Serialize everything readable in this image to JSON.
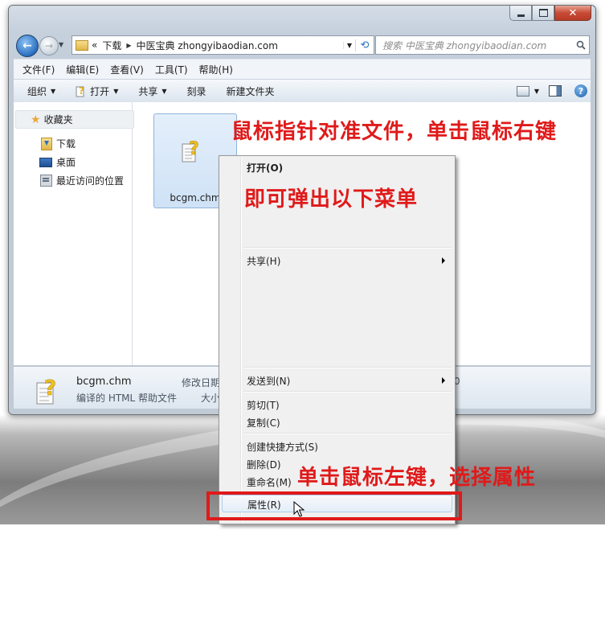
{
  "window": {
    "caption_buttons": {
      "close_glyph": "✕"
    }
  },
  "address": {
    "overflow": "«",
    "crumbs": [
      "下载",
      "中医宝典 zhongyibaodian.com"
    ]
  },
  "search": {
    "placeholder": "搜索 中医宝典 zhongyibaodian.com"
  },
  "menubar": [
    "文件(F)",
    "编辑(E)",
    "查看(V)",
    "工具(T)",
    "帮助(H)"
  ],
  "toolbar": {
    "organize": "组织",
    "open": "打开",
    "share": "共享",
    "burn": "刻录",
    "new_folder": "新建文件夹",
    "help_glyph": "?"
  },
  "navpane": {
    "favorites": "收藏夹",
    "items": [
      "下载",
      "桌面",
      "最近访问的位置"
    ]
  },
  "file": {
    "name": "bcgm.chm"
  },
  "details": {
    "name": "bcgm.chm",
    "type": "编译的 HTML 帮助文件",
    "modified_label": "修改日期",
    "size_label": "大小",
    "partial_value": "0"
  },
  "context_menu": {
    "open": "打开(O)",
    "share": "共享(H)",
    "send_to": "发送到(N)",
    "cut": "剪切(T)",
    "copy": "复制(C)",
    "create_shortcut": "创建快捷方式(S)",
    "delete": "删除(D)",
    "rename": "重命名(M)",
    "properties": "属性(R)"
  },
  "annotations": {
    "step1": "鼠标指针对准文件，单击鼠标右键",
    "step2": "即可弹出以下菜单",
    "step3": "单击鼠标左键，选择属性",
    "color": "#e01a1a"
  }
}
